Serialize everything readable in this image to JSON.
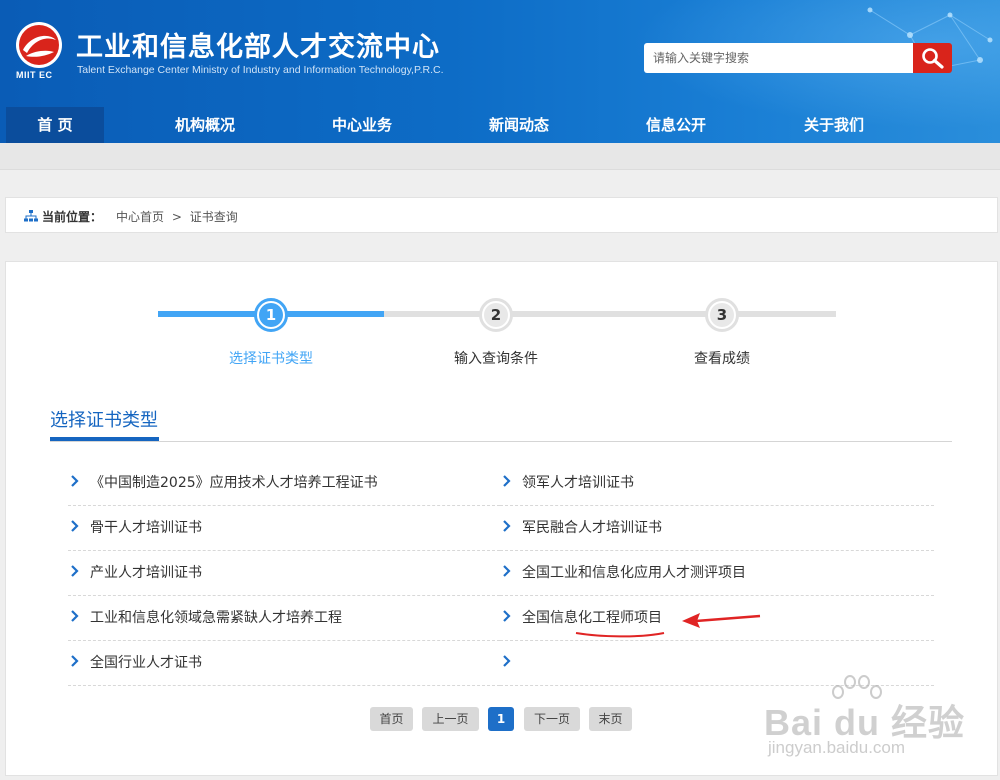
{
  "header": {
    "logo_text": "MIIT EC",
    "title": "工业和信息化部人才交流中心",
    "subtitle": "Talent Exchange Center Ministry of Industry and Information Technology,P.R.C.",
    "search_placeholder": "请输入关键字搜索",
    "search_icon": "search-icon",
    "brand_red": "#d9241b",
    "brand_blue": "#0d6cc6"
  },
  "nav": {
    "items": [
      {
        "label": "首  页",
        "active": true
      },
      {
        "label": "机构概况"
      },
      {
        "label": "中心业务"
      },
      {
        "label": "新闻动态"
      },
      {
        "label": "信息公开"
      },
      {
        "label": "关于我们"
      }
    ]
  },
  "breadcrumb": {
    "label": "当前位置：",
    "home": "中心首页",
    "separator": ">",
    "current": "证书查询"
  },
  "steps": [
    {
      "number": "1",
      "label": "选择证书类型",
      "active": true
    },
    {
      "number": "2",
      "label": "输入查询条件"
    },
    {
      "number": "3",
      "label": "查看成绩"
    }
  ],
  "section_title": "选择证书类型",
  "certificates": {
    "left": [
      "《中国制造2025》应用技术人才培养工程证书",
      "骨干人才培训证书",
      "产业人才培训证书",
      "工业和信息化领域急需紧缺人才培养工程",
      "全国行业人才证书"
    ],
    "right": [
      "领军人才培训证书",
      "军民融合人才培训证书",
      "全国工业和信息化应用人才测评项目",
      "全国信息化工程师项目",
      ""
    ]
  },
  "pagination": {
    "first": "首页",
    "prev": "上一页",
    "current": "1",
    "next": "下一页",
    "last": "末页"
  },
  "watermark": {
    "brand": "Bai du 经验",
    "url": "jingyan.baidu.com"
  }
}
